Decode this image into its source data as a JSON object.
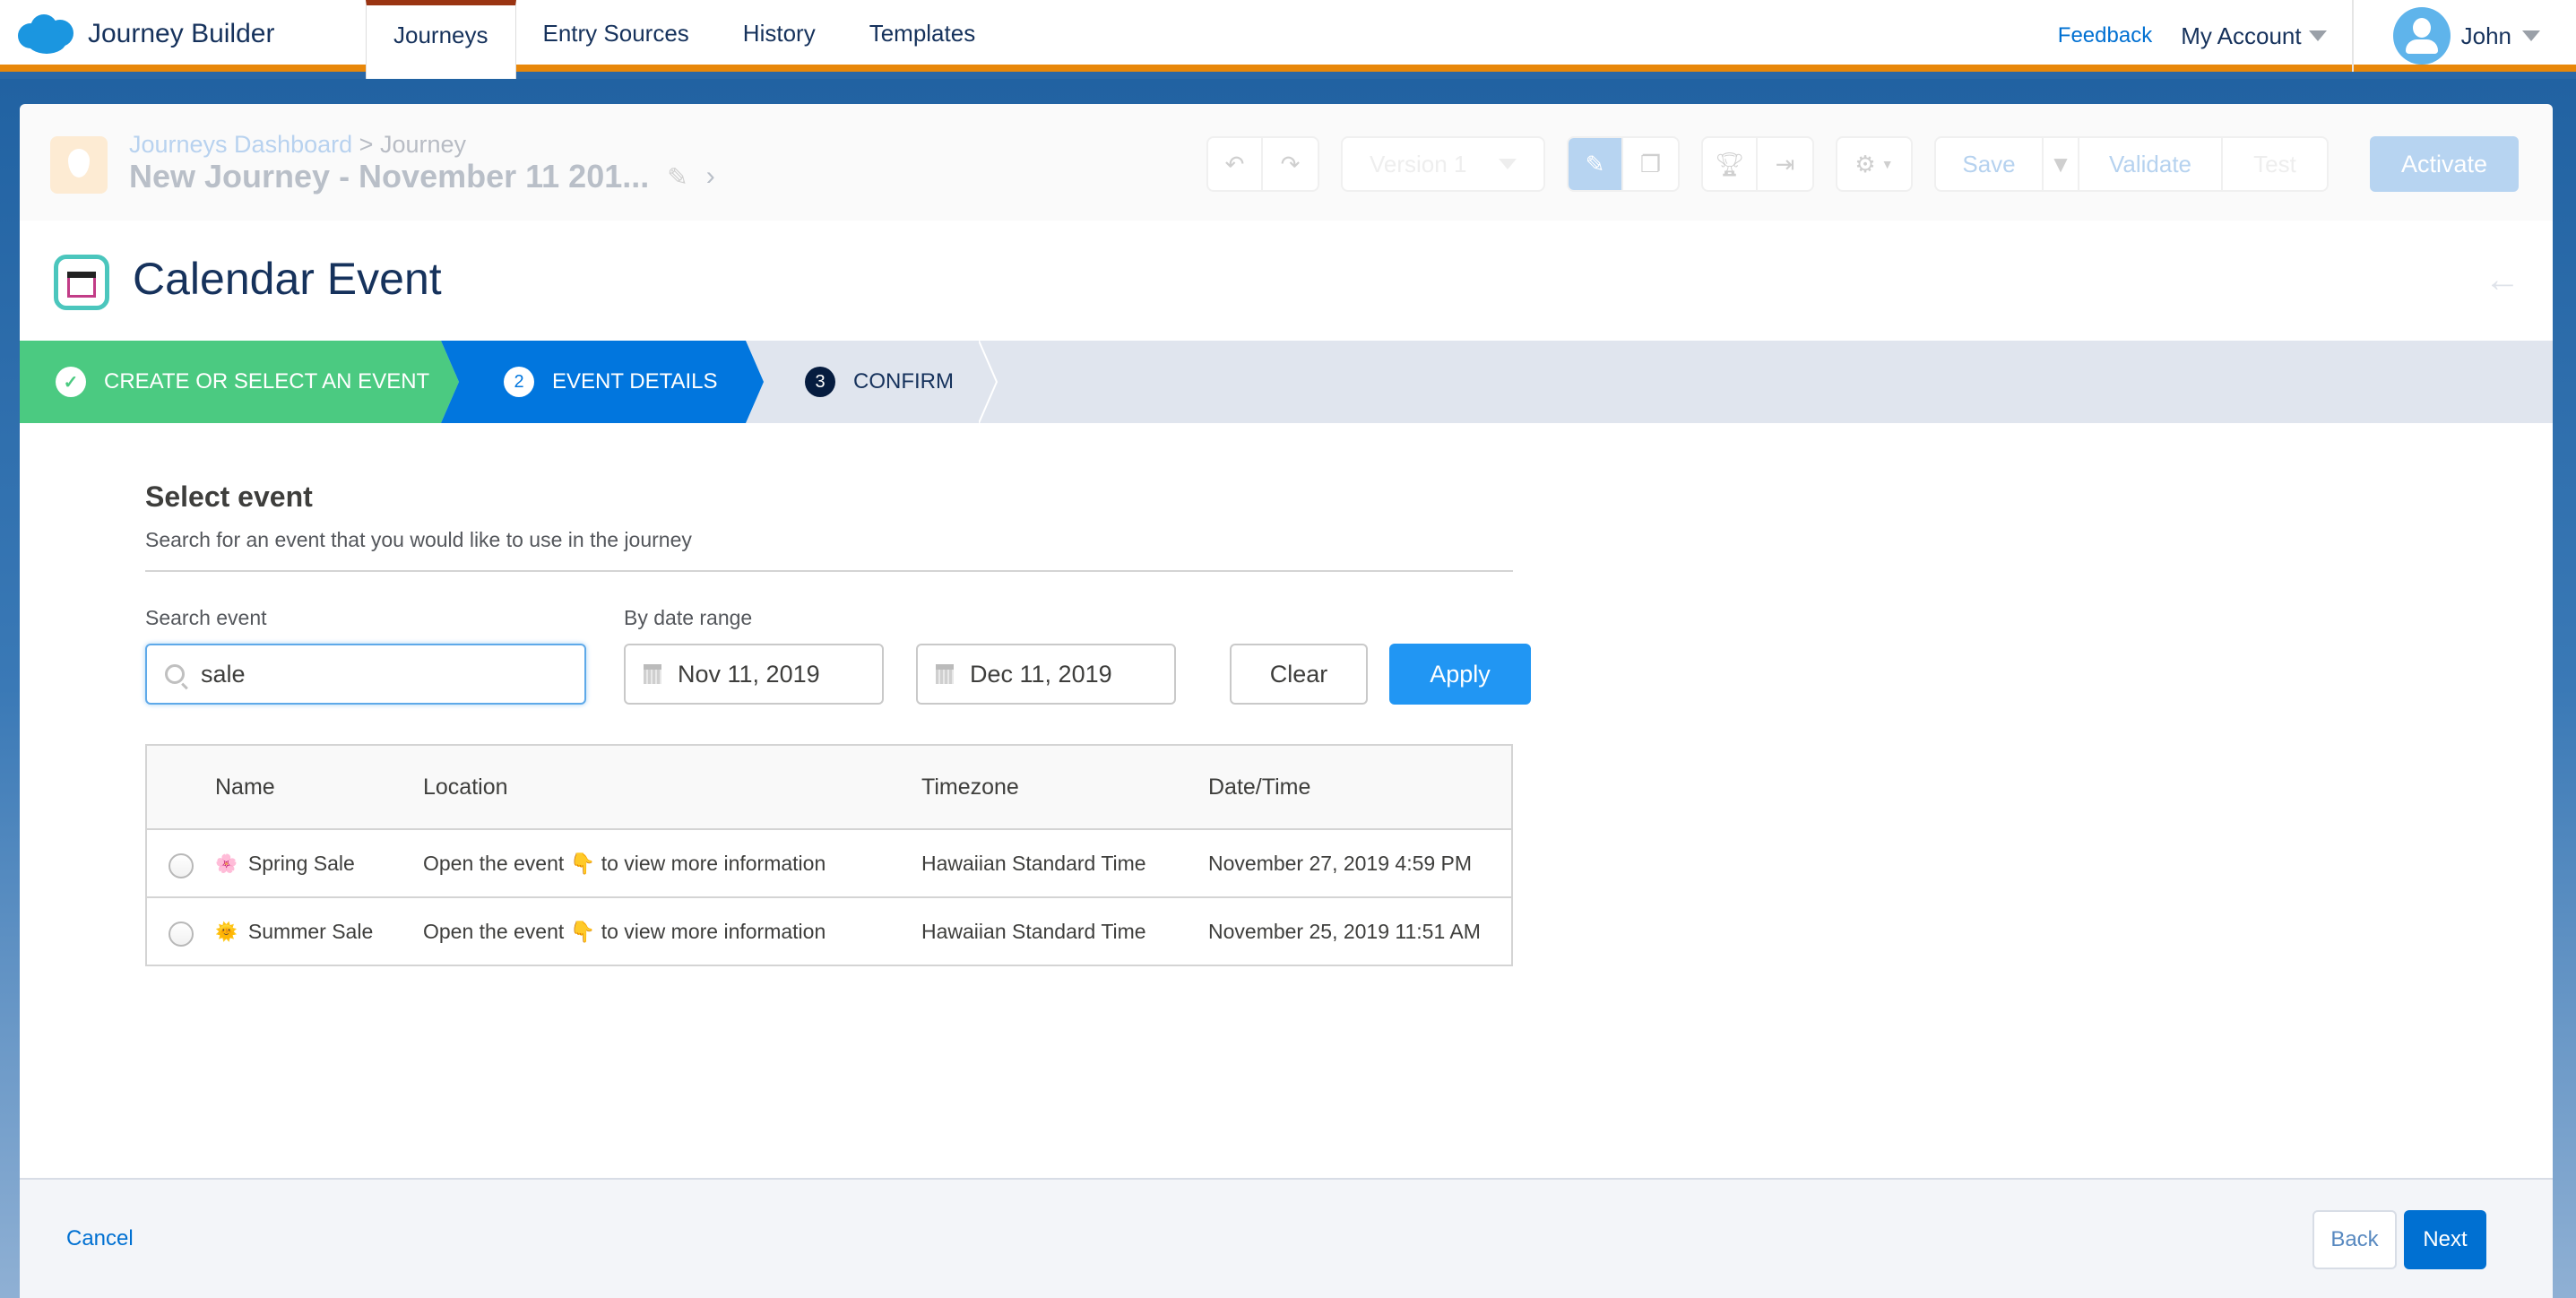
{
  "app": {
    "title": "Journey Builder",
    "nav_tabs": [
      {
        "label": "Journeys",
        "active": true
      },
      {
        "label": "Entry Sources",
        "active": false
      },
      {
        "label": "History",
        "active": false
      },
      {
        "label": "Templates",
        "active": false
      }
    ],
    "feedback_label": "Feedback",
    "account_label": "My Account",
    "user_name": "John"
  },
  "journey": {
    "breadcrumb_parent": "Journeys Dashboard",
    "breadcrumb_separator": ">",
    "breadcrumb_current": "Journey",
    "title": "New Journey - November 11 201...",
    "version_label": "Version 1",
    "save_label": "Save",
    "validate_label": "Validate",
    "test_label": "Test",
    "activate_label": "Activate"
  },
  "modal": {
    "title": "Calendar Event",
    "steps": [
      {
        "number": "✓",
        "label": "Create or Select an Event",
        "state": "complete"
      },
      {
        "number": "2",
        "label": "Event Details",
        "state": "current"
      },
      {
        "number": "3",
        "label": "Confirm",
        "state": "upcoming"
      }
    ],
    "section_title": "Select event",
    "section_subtitle": "Search for an event that you would like to use in the journey",
    "search": {
      "label": "Search event",
      "value": "sale"
    },
    "date_range": {
      "label": "By date range",
      "start": "Nov 11, 2019",
      "end": "Dec 11, 2019"
    },
    "clear_label": "Clear",
    "apply_label": "Apply",
    "table": {
      "columns": [
        "Name",
        "Location",
        "Timezone",
        "Date/Time"
      ],
      "rows": [
        {
          "emoji": "🌸",
          "name": "Spring Sale",
          "location": "Open the event 👇 to view more information",
          "timezone": "Hawaiian Standard Time",
          "datetime": "November 27, 2019 4:59 PM",
          "selected": false
        },
        {
          "emoji": "🌞",
          "name": "Summer Sale",
          "location": "Open the event 👇 to view more information",
          "timezone": "Hawaiian Standard Time",
          "datetime": "November 25, 2019 11:51 AM",
          "selected": false
        }
      ]
    },
    "footer": {
      "cancel_label": "Cancel",
      "back_label": "Back",
      "next_label": "Next"
    }
  },
  "colors": {
    "brand_blue": "#0070d2",
    "step_complete": "#4bca81",
    "step_current": "#0176de",
    "nav_accent": "#e8870a",
    "apply_button": "#2196f3"
  }
}
